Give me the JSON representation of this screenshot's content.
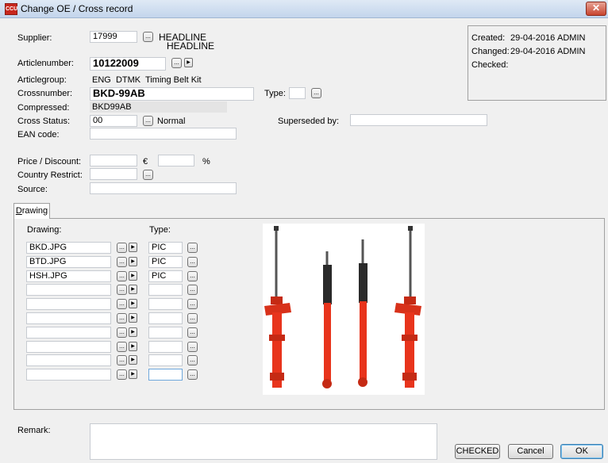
{
  "window": {
    "title": "Change OE / Cross record",
    "icon_text": "CCU",
    "close_glyph": "✕"
  },
  "form": {
    "supplier": {
      "label": "Supplier:",
      "value": "17999",
      "name1": "HEADLINE",
      "name2": "HEADLINE"
    },
    "articlenumber": {
      "label": "Articlenumber:",
      "value": "10122009"
    },
    "articlegroup": {
      "label": "Articlegroup:",
      "value": "ENG  DTMK  Timing Belt Kit"
    },
    "crossnumber": {
      "label": "Crossnumber:",
      "value": "BKD-99AB"
    },
    "type": {
      "label": "Type:",
      "value": ""
    },
    "compressed": {
      "label": "Compressed:",
      "value": "BKD99AB"
    },
    "cross_status": {
      "label": "Cross Status:",
      "value": "00",
      "text": "Normal"
    },
    "superseded_by": {
      "label": "Superseded by:",
      "value": ""
    },
    "ean_code": {
      "label": "EAN code:",
      "value": ""
    },
    "price_discount": {
      "label": "Price / Discount:",
      "currency": "€",
      "percent": "%",
      "price": "",
      "discount": ""
    },
    "country_restrict": {
      "label": "Country Restrict:",
      "value": ""
    },
    "source": {
      "label": "Source:",
      "value": ""
    }
  },
  "info": {
    "created_label": "Created:",
    "created_date": "29-04-2016",
    "created_user": "ADMIN",
    "changed_label": "Changed:",
    "changed_date": "29-04-2016",
    "changed_user": "ADMIN",
    "checked_label": "Checked:"
  },
  "tab": {
    "label_first": "D",
    "label_rest": "rawing"
  },
  "drawing": {
    "col_drawing": "Drawing:",
    "col_type": "Type:",
    "rows": [
      {
        "file": "BKD.JPG",
        "type": "PIC"
      },
      {
        "file": "BTD.JPG",
        "type": "PIC"
      },
      {
        "file": "HSH.JPG",
        "type": "PIC"
      },
      {
        "file": "",
        "type": ""
      },
      {
        "file": "",
        "type": ""
      },
      {
        "file": "",
        "type": ""
      },
      {
        "file": "",
        "type": ""
      },
      {
        "file": "",
        "type": ""
      },
      {
        "file": "",
        "type": ""
      },
      {
        "file": "",
        "type": ""
      }
    ]
  },
  "remark": {
    "label": "Remark:",
    "value": ""
  },
  "buttons": {
    "checked": "CHECKED",
    "cancel": "Cancel",
    "ok": "OK"
  },
  "glyphs": {
    "dots": "...",
    "arrow": "▶"
  },
  "colors": {
    "shock_body": "#e8341c",
    "shock_boot": "#2a2a2a",
    "title_red": "#c8281e"
  }
}
